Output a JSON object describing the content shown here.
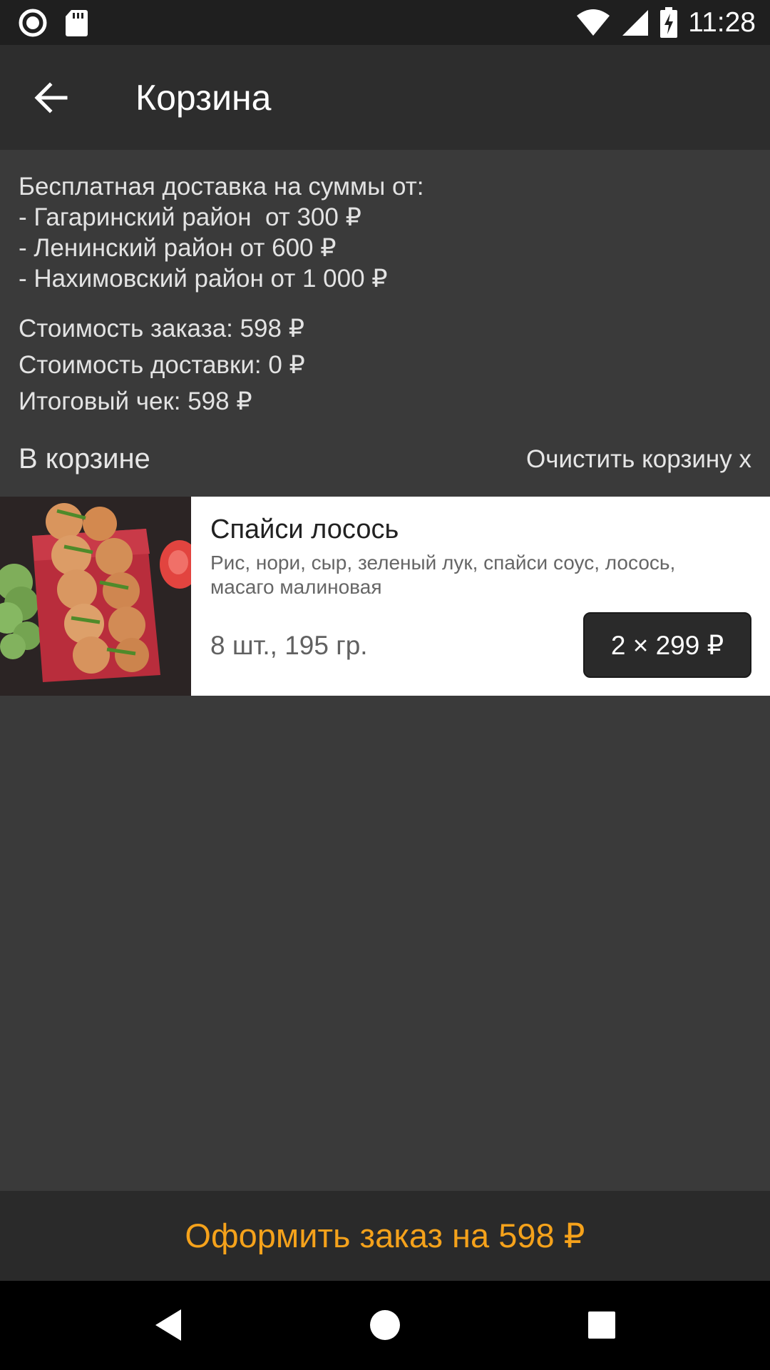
{
  "status_bar": {
    "time": "11:28",
    "icons": [
      "record-icon",
      "sd-card-icon",
      "wifi-icon",
      "cellular-signal-icon",
      "battery-charging-icon"
    ]
  },
  "app_bar": {
    "title": "Корзина",
    "back_icon": "arrow-back-icon"
  },
  "delivery_info": {
    "lines": [
      "Бесплатная доставка на суммы от:",
      "- Гагаринский район  от 300 ₽",
      "- Ленинский район от 600 ₽",
      "- Нахимовский район от 1 000 ₽"
    ]
  },
  "totals": {
    "order_cost": "Стоимость заказа: 598 ₽",
    "delivery_cost": "Стоимость доставки: 0 ₽",
    "final": "Итоговый чек: 598 ₽"
  },
  "cart": {
    "label": "В корзине",
    "clear_label": "Очистить корзину x",
    "items": [
      {
        "name": "Спайси лосось",
        "description": "Рис, нори, сыр, зеленый лук, спайси соус, лосось, масаго малиновая",
        "meta": "8 шт., 195 гр.",
        "quantity_price": "2 × 299 ₽",
        "image": "sushi-roll-photo"
      }
    ]
  },
  "checkout": {
    "label": "Оформить заказ на 598 ₽"
  },
  "nav_bar": {
    "icons": [
      "nav-back-icon",
      "nav-home-icon",
      "nav-recents-icon"
    ]
  },
  "colors": {
    "background": "#3a3a3a",
    "app_bar": "#2d2d2d",
    "accent": "#f5a21b",
    "card": "#ffffff"
  }
}
